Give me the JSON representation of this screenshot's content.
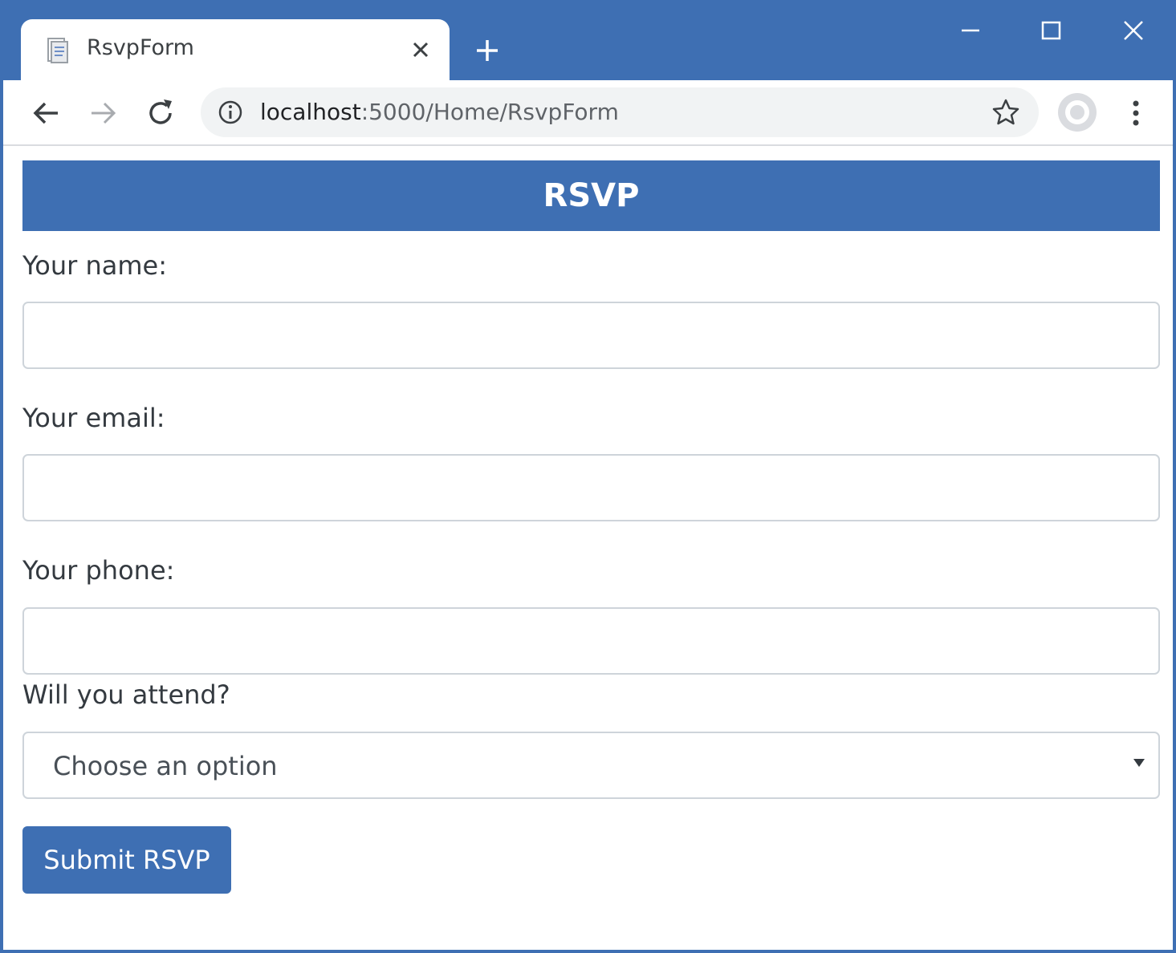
{
  "browser": {
    "tab": {
      "title": "RsvpForm"
    },
    "address_bar": {
      "host": "localhost",
      "path": ":5000/Home/RsvpForm"
    },
    "icons": {
      "favicon": "page-icon",
      "tab_close": "close-icon",
      "new_tab": "plus-icon",
      "minimize": "minimize-icon",
      "maximize": "maximize-icon",
      "window_close": "close-icon",
      "back": "arrow-left-icon",
      "forward": "arrow-right-icon",
      "reload": "reload-icon",
      "site_info": "info-icon",
      "bookmark": "star-icon",
      "profile": "avatar-icon",
      "menu": "kebab-menu-icon"
    },
    "colors": {
      "frame": "#3e6fb3",
      "omnibox": "#f1f3f4"
    }
  },
  "page": {
    "banner": {
      "title": "RSVP",
      "color": "#3e6fb3"
    },
    "form": {
      "name": {
        "label": "Your name:",
        "value": ""
      },
      "email": {
        "label": "Your email:",
        "value": ""
      },
      "phone": {
        "label": "Your phone:",
        "value": ""
      },
      "attend": {
        "label": "Will you attend?",
        "selected": "Choose an option"
      },
      "submit_label": "Submit RSVP"
    }
  }
}
